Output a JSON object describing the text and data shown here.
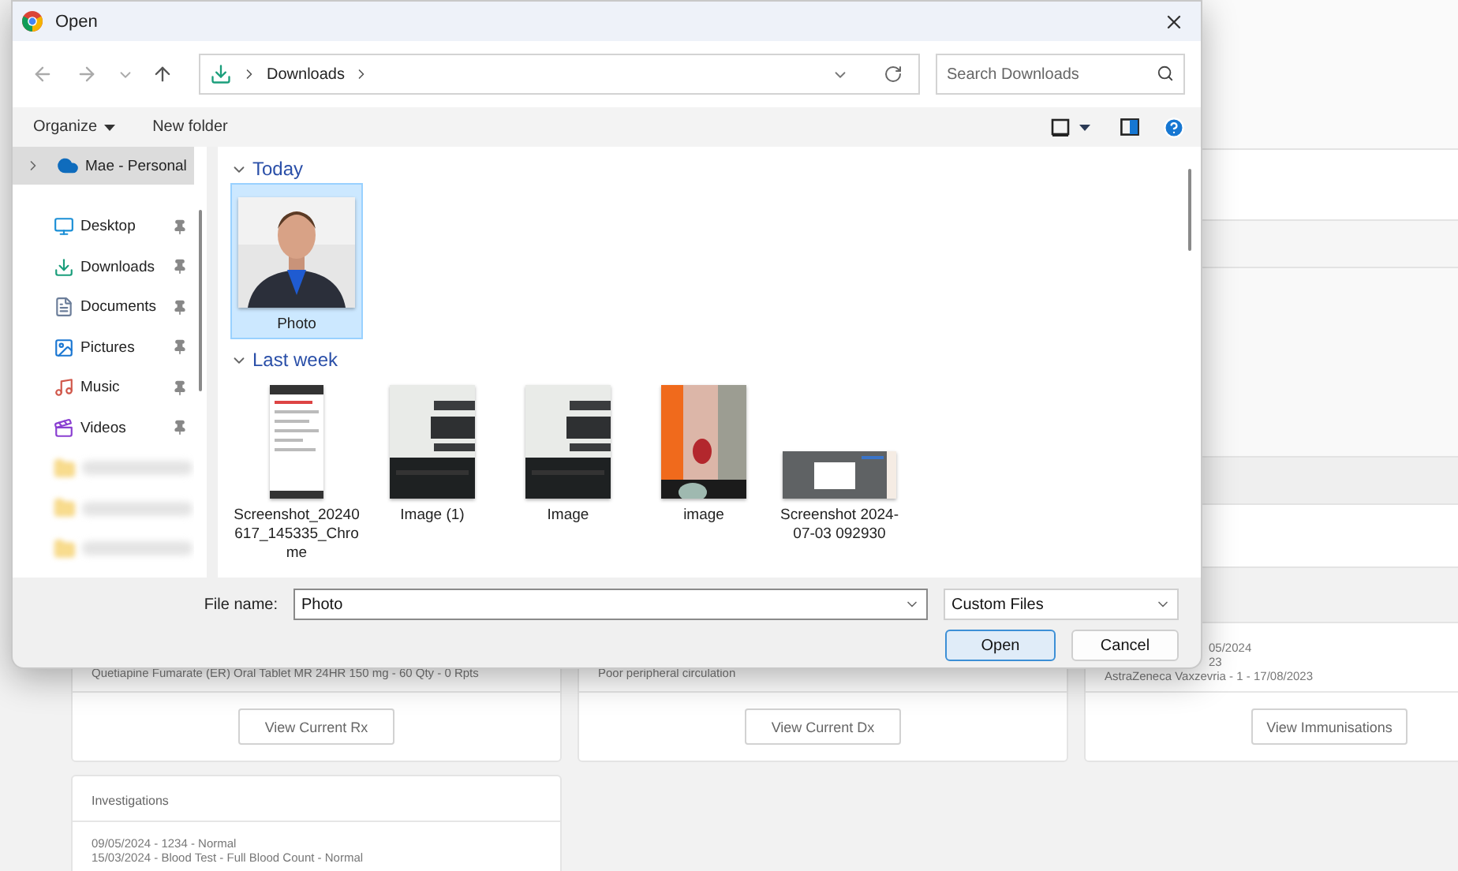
{
  "page": {
    "cards": [
      {
        "lines": [
          "Quetiapine Fumarate (ER) Oral Tablet MR 24HR 150 mg - 60 Qty - 0 Rpts"
        ],
        "button": "View Current Rx"
      },
      {
        "lines": [
          "Poor peripheral circulation"
        ],
        "button": "View Current Dx"
      },
      {
        "lines": [
          "05/2024",
          "23",
          "AstraZeneca Vaxzevria - 1 - 17/08/2023"
        ],
        "button": "View Immunisations"
      }
    ],
    "investigations": {
      "title": "Investigations",
      "lines": [
        "09/05/2024 - 1234 - Normal",
        "15/03/2024 - Blood Test - Full Blood Count - Normal"
      ]
    }
  },
  "dialog": {
    "title": "Open",
    "breadcrumb": [
      "Downloads"
    ],
    "search": {
      "placeholder": "Search Downloads"
    },
    "commands": [
      {
        "label": "Organize",
        "menu": true
      },
      {
        "label": "New folder",
        "menu": false
      }
    ],
    "sidebar": [
      {
        "kind": "cloud",
        "label": "Mae - Personal",
        "selected": true,
        "pinned": false
      },
      {
        "kind": "desktop",
        "label": "Desktop",
        "selected": false,
        "pinned": true
      },
      {
        "kind": "downloads",
        "label": "Downloads",
        "selected": false,
        "pinned": true
      },
      {
        "kind": "documents",
        "label": "Documents",
        "selected": false,
        "pinned": true
      },
      {
        "kind": "pictures",
        "label": "Pictures",
        "selected": false,
        "pinned": true
      },
      {
        "kind": "music",
        "label": "Music",
        "selected": false,
        "pinned": true
      },
      {
        "kind": "videos",
        "label": "Videos",
        "selected": false,
        "pinned": true
      },
      {
        "kind": "redacted",
        "selected": false,
        "pinned": false
      },
      {
        "kind": "redacted",
        "selected": false,
        "pinned": false
      },
      {
        "kind": "redacted",
        "selected": false,
        "pinned": false
      }
    ],
    "groups": [
      {
        "label": "Today",
        "expanded": true,
        "files": [
          {
            "name": "Photo",
            "kind": "picture",
            "selected": true
          }
        ]
      },
      {
        "label": "Last week",
        "expanded": true,
        "files": [
          {
            "name": "Screenshot_20240617_145335_Chrome",
            "kind": "picture",
            "selected": false
          },
          {
            "name": "Image (1)",
            "kind": "picture",
            "selected": false
          },
          {
            "name": "Image",
            "kind": "picture",
            "selected": false
          },
          {
            "name": "image",
            "kind": "picture",
            "selected": false
          },
          {
            "name": "Screenshot 2024-07-03 092930",
            "kind": "picture",
            "selected": false
          }
        ]
      }
    ],
    "file_name": {
      "label": "File name:",
      "value": "Photo"
    },
    "file_type": {
      "value": "Custom Files"
    },
    "buttons": [
      {
        "label": "Open",
        "default": true
      },
      {
        "label": "Cancel",
        "default": false
      }
    ]
  }
}
